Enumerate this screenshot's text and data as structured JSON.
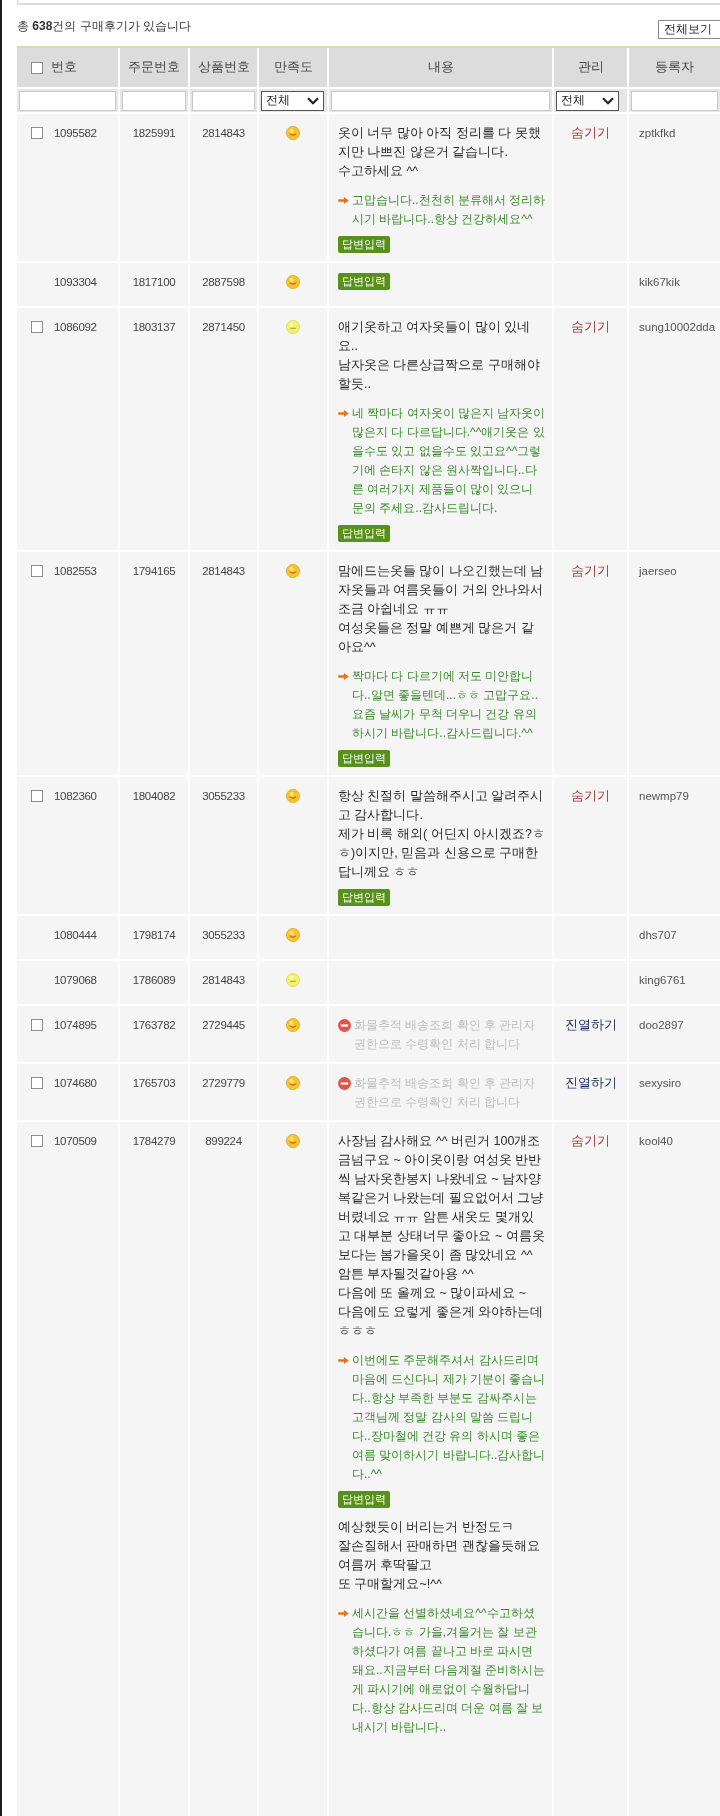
{
  "summary": "총 **638**건의 구매후기가 있습니다",
  "view_select": {
    "value": "전체보기"
  },
  "table": {
    "columns": [
      {
        "label": "번호",
        "checkbox": {
          "checked": false
        },
        "filter": {
          "kind": "input"
        }
      },
      {
        "label": "주문번호",
        "filter": {
          "kind": "input"
        }
      },
      {
        "label": "상품번호",
        "filter": {
          "kind": "input"
        }
      },
      {
        "label": "만족도",
        "filter": {
          "kind": "select",
          "value": "전체"
        }
      },
      {
        "label": "내용",
        "filter": {
          "kind": "input"
        }
      },
      {
        "label": "관리",
        "filter": {
          "kind": "select",
          "value": "전체"
        }
      },
      {
        "label": "등록자",
        "filter": {
          "kind": "input"
        }
      }
    ],
    "rows": [
      {
        "checkbox": {
          "checked": false
        },
        "number": "1095582",
        "order_no": "1825991",
        "product_no": "2814843",
        "satisfaction": {
          "kind": "smile"
        },
        "content": [
          {
            "kind": "review",
            "text": "옷이 너무 많아 아직 정리를 다 못했지만 나쁘진 않은거 같습니다.\n수고하세요 ^^"
          },
          {
            "kind": "reply",
            "text": "고맙습니다..천천히 분류해서 정리하시기 바랍니다..항상 건강하세요^^"
          },
          {
            "kind": "button",
            "label": "답변입력"
          }
        ],
        "action": {
          "kind": "hide",
          "label": "숨기기"
        },
        "author": "zptkfkd"
      },
      {
        "number": "1093304",
        "order_no": "1817100",
        "product_no": "2887598",
        "satisfaction": {
          "kind": "smile"
        },
        "content": [
          {
            "kind": "button",
            "label": "답변입력"
          }
        ],
        "author": "kik67kik"
      },
      {
        "checkbox": {
          "checked": false
        },
        "number": "1086092",
        "order_no": "1803137",
        "product_no": "2871450",
        "satisfaction": {
          "kind": "neutral"
        },
        "content": [
          {
            "kind": "review",
            "text": "애기옷하고 여자옷들이 많이 있네요..\n남자옷은 다른상급짝으로 구매해야할듯.."
          },
          {
            "kind": "reply",
            "text": "네 짝마다 여자옷이 많은지 남자옷이 많은지 다 다르답니다.^^애기옷은 있을수도 있고 없을수도 있고요^^그렇기에 손타지 않은 원사짝입니다..다른 여러가지 제품들이 많이 있으니 문의 주세요..감사드립니다."
          },
          {
            "kind": "button",
            "label": "답변입력"
          }
        ],
        "action": {
          "kind": "hide",
          "label": "숨기기"
        },
        "author": "sung10002dda"
      },
      {
        "checkbox": {
          "checked": false
        },
        "number": "1082553",
        "order_no": "1794165",
        "product_no": "2814843",
        "satisfaction": {
          "kind": "smile"
        },
        "content": [
          {
            "kind": "review",
            "text": "맘에드는옷들 많이 나오긴했는데 남자옷들과 여름옷들이 거의 안나와서 조금 아쉽네요 ㅠㅠ\n여성옷들은 정말 예쁜게 많은거 같아요^^"
          },
          {
            "kind": "reply",
            "text": "짝마다 다 다르기에 저도 미안합니다..알면 좋을텐데...ㅎㅎ 고맙구요..요즘 날씨가 무척 더우니 건강 유의하시기 바랍니다..감사드립니다.^^"
          },
          {
            "kind": "button",
            "label": "답변입력"
          }
        ],
        "action": {
          "kind": "hide",
          "label": "숨기기"
        },
        "author": "jaerseo"
      },
      {
        "checkbox": {
          "checked": false
        },
        "number": "1082360",
        "order_no": "1804082",
        "product_no": "3055233",
        "satisfaction": {
          "kind": "smile"
        },
        "content": [
          {
            "kind": "review",
            "text": "항상 친절히 말씀해주시고 알려주시고 감사합니다.\n제가 비록 해외( 어딘지 아시겠죠?ㅎㅎ)이지만, 믿음과 신용으로 구매한답니께요 ㅎㅎ"
          },
          {
            "kind": "button",
            "label": "답변입력"
          }
        ],
        "action": {
          "kind": "hide",
          "label": "숨기기"
        },
        "author": "newmp79"
      },
      {
        "number": "1080444",
        "order_no": "1798174",
        "product_no": "3055233",
        "satisfaction": {
          "kind": "smile"
        },
        "content": [],
        "author": "dhs707"
      },
      {
        "number": "1079068",
        "order_no": "1786089",
        "product_no": "2814843",
        "satisfaction": {
          "kind": "neutral"
        },
        "content": [],
        "author": "king6761"
      },
      {
        "checkbox": {
          "checked": false
        },
        "number": "1074895",
        "order_no": "1763782",
        "product_no": "2729445",
        "satisfaction": {
          "kind": "smile"
        },
        "content": [
          {
            "kind": "notice",
            "text": "화물추적 배송조회 확인 후 관리자 권한으로 수령확인 처리 합니다"
          }
        ],
        "action": {
          "kind": "display",
          "label": "진열하기"
        },
        "author": "doo2897"
      },
      {
        "checkbox": {
          "checked": false
        },
        "number": "1074680",
        "order_no": "1765703",
        "product_no": "2729779",
        "satisfaction": {
          "kind": "smile"
        },
        "content": [
          {
            "kind": "notice",
            "text": "화물추적 배송조회 확인 후 관리자 권한으로 수령확인 처리 합니다"
          }
        ],
        "action": {
          "kind": "display",
          "label": "진열하기"
        },
        "author": "sexysiro"
      },
      {
        "checkbox": {
          "checked": false
        },
        "number": "1070509",
        "order_no": "1784279",
        "product_no": "899224",
        "satisfaction": {
          "kind": "smile"
        },
        "content": [
          {
            "kind": "review",
            "text": "사장님 감사해요 ^^ 버린거 100개조금넘구요 ~ 아이옷이랑 여성옷 반반씩 남자옷한봉지 나왔네요 ~ 남자양복같은거 나왔는데 필요없어서 그냥 버렸네요 ㅠㅠ 암튼 새옷도 몇개있고 대부분 상태너무 좋아요 ~ 여름옷보다는 봄가을옷이 좀 많았네요 ^^ 암튼 부자될것같아용 ^^\n다음에 또 올께요 ~ 많이파세요 ~\n다음에도 요렇게 좋은게 와야하는데 ㅎㅎㅎ"
          },
          {
            "kind": "reply",
            "text": "이번에도 주문해주셔서 감사드리며 마음에 드신다니 제가 기분이 좋습니다..항상 부족한 부분도 감싸주시는 고객님께 정말 감사의 말씀 드립니다..장마철에 건강 유의 하시며 좋은 여름 맞이하시기 바랍니다..감사합니다..^^"
          },
          {
            "kind": "button",
            "label": "답변입력"
          },
          {
            "kind": "review",
            "text": "예상했듯이 버리는거 반정도ㅋ\n잘손질해서 판매하면 괜찮을듯해요\n여름꺼 후딱팔고\n또 구매할게요~!^^"
          },
          {
            "kind": "reply",
            "text": "세시간을 선별하셨네요^^수고하셨습니다.ㅎㅎ 가을,겨울거는 잘 보관하셨다가 여름 끝나고 바로 파시면 돼요..지금부터 다음계절 준비하시는게 파시기에 애로없이 수월하답니다..항상 감사드리며 더운 여름 잘 보내시기 바랍니다.."
          }
        ],
        "action": {
          "kind": "hide",
          "label": "숨기기"
        },
        "author": "kool40"
      }
    ]
  }
}
